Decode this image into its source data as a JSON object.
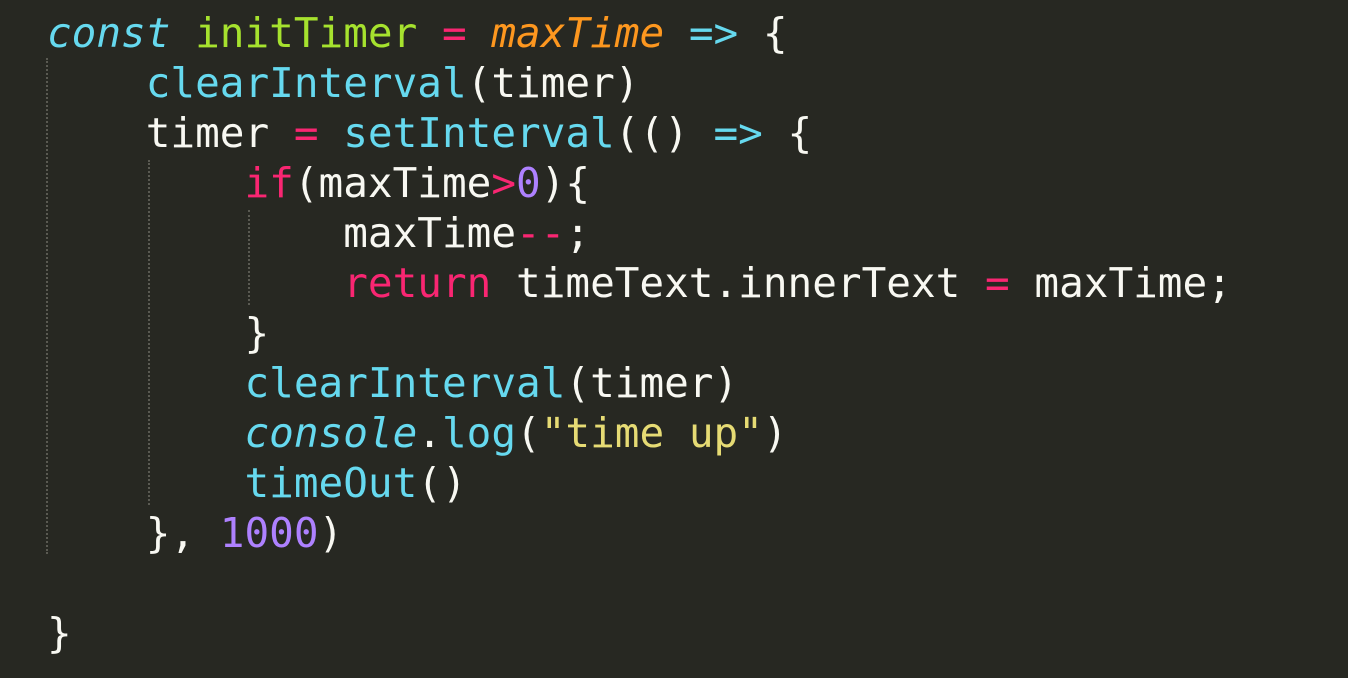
{
  "editor": {
    "theme_colors": {
      "background": "#272822",
      "foreground": "#F8F8F2",
      "keyword": "#F92672",
      "function": "#66D9EF",
      "entity": "#A6E22E",
      "parameter": "#FD971F",
      "number": "#AE81FF",
      "string": "#E6DB74"
    },
    "lines": [
      [
        {
          "text": "const",
          "cls": "t-storage"
        },
        {
          "text": " ",
          "cls": "t-plain"
        },
        {
          "text": "initTimer",
          "cls": "t-entity"
        },
        {
          "text": " ",
          "cls": "t-plain"
        },
        {
          "text": "=",
          "cls": "t-op"
        },
        {
          "text": " ",
          "cls": "t-plain"
        },
        {
          "text": "maxTime",
          "cls": "t-param"
        },
        {
          "text": " ",
          "cls": "t-plain"
        },
        {
          "text": "=>",
          "cls": "t-arrow"
        },
        {
          "text": " {",
          "cls": "t-plain"
        }
      ],
      [
        {
          "text": "    ",
          "cls": "t-plain"
        },
        {
          "text": "clearInterval",
          "cls": "t-func"
        },
        {
          "text": "(timer)",
          "cls": "t-plain"
        }
      ],
      [
        {
          "text": "    timer ",
          "cls": "t-plain"
        },
        {
          "text": "=",
          "cls": "t-op"
        },
        {
          "text": " ",
          "cls": "t-plain"
        },
        {
          "text": "setInterval",
          "cls": "t-func"
        },
        {
          "text": "(() ",
          "cls": "t-plain"
        },
        {
          "text": "=>",
          "cls": "t-arrow"
        },
        {
          "text": " {",
          "cls": "t-plain"
        }
      ],
      [
        {
          "text": "        ",
          "cls": "t-plain"
        },
        {
          "text": "if",
          "cls": "t-kw"
        },
        {
          "text": "(maxTime",
          "cls": "t-plain"
        },
        {
          "text": ">",
          "cls": "t-op"
        },
        {
          "text": "0",
          "cls": "t-num"
        },
        {
          "text": "){",
          "cls": "t-plain"
        }
      ],
      [
        {
          "text": "            maxTime",
          "cls": "t-plain"
        },
        {
          "text": "--",
          "cls": "t-op"
        },
        {
          "text": ";",
          "cls": "t-plain"
        }
      ],
      [
        {
          "text": "            ",
          "cls": "t-plain"
        },
        {
          "text": "return",
          "cls": "t-kw"
        },
        {
          "text": " timeText.innerText ",
          "cls": "t-plain"
        },
        {
          "text": "=",
          "cls": "t-op"
        },
        {
          "text": " maxTime;",
          "cls": "t-plain"
        }
      ],
      [
        {
          "text": "        }",
          "cls": "t-plain"
        }
      ],
      [
        {
          "text": "        ",
          "cls": "t-plain"
        },
        {
          "text": "clearInterval",
          "cls": "t-func"
        },
        {
          "text": "(timer)",
          "cls": "t-plain"
        }
      ],
      [
        {
          "text": "        ",
          "cls": "t-plain"
        },
        {
          "text": "console",
          "cls": "t-italic-support"
        },
        {
          "text": ".",
          "cls": "t-plain"
        },
        {
          "text": "log",
          "cls": "t-func"
        },
        {
          "text": "(",
          "cls": "t-plain"
        },
        {
          "text": "\"time up\"",
          "cls": "t-string"
        },
        {
          "text": ")",
          "cls": "t-plain"
        }
      ],
      [
        {
          "text": "        ",
          "cls": "t-plain"
        },
        {
          "text": "timeOut",
          "cls": "t-func"
        },
        {
          "text": "()",
          "cls": "t-plain"
        }
      ],
      [
        {
          "text": "    }, ",
          "cls": "t-plain"
        },
        {
          "text": "1000",
          "cls": "t-num"
        },
        {
          "text": ")",
          "cls": "t-plain"
        }
      ],
      [],
      [
        {
          "text": "}",
          "cls": "t-plain"
        }
      ]
    ]
  }
}
